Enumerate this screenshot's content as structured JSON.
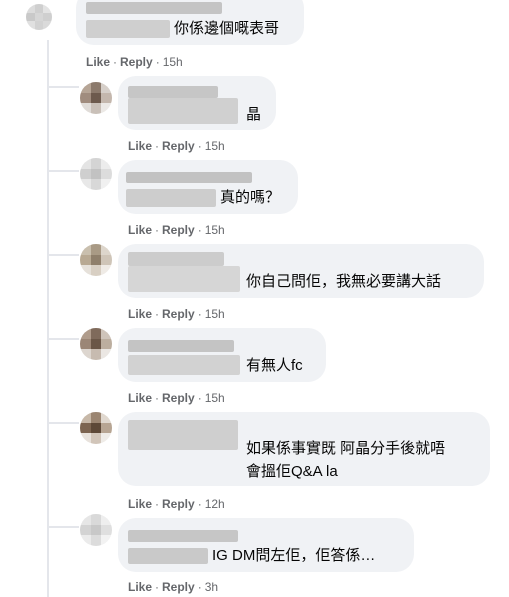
{
  "comments": [
    {
      "text": "你係邊個嘅表哥",
      "like": "Like",
      "reply": "Reply",
      "time": "15h"
    },
    {
      "text": "晶",
      "like": "Like",
      "reply": "Reply",
      "time": "15h"
    },
    {
      "text": "真的嗎？",
      "like": "Like",
      "reply": "Reply",
      "time": "15h"
    },
    {
      "text": "你自己問佢，我無必要講大話",
      "like": "Like",
      "reply": "Reply",
      "time": "15h"
    },
    {
      "text": "有無人fc",
      "like": "Like",
      "reply": "Reply",
      "time": "15h"
    },
    {
      "text_line1": "如果係事實既 阿晶分手後就唔",
      "text_line2": "會搵佢Q&A la",
      "like": "Like",
      "reply": "Reply",
      "time": "12h"
    },
    {
      "text": "IG DM問左佢，佢答係…",
      "like": "Like",
      "reply": "Reply",
      "time": "3h"
    }
  ],
  "colors": {
    "bubble": "#f0f2f5",
    "meta": "#65676b",
    "text": "#050505",
    "thread_line": "#e4e6eb"
  }
}
